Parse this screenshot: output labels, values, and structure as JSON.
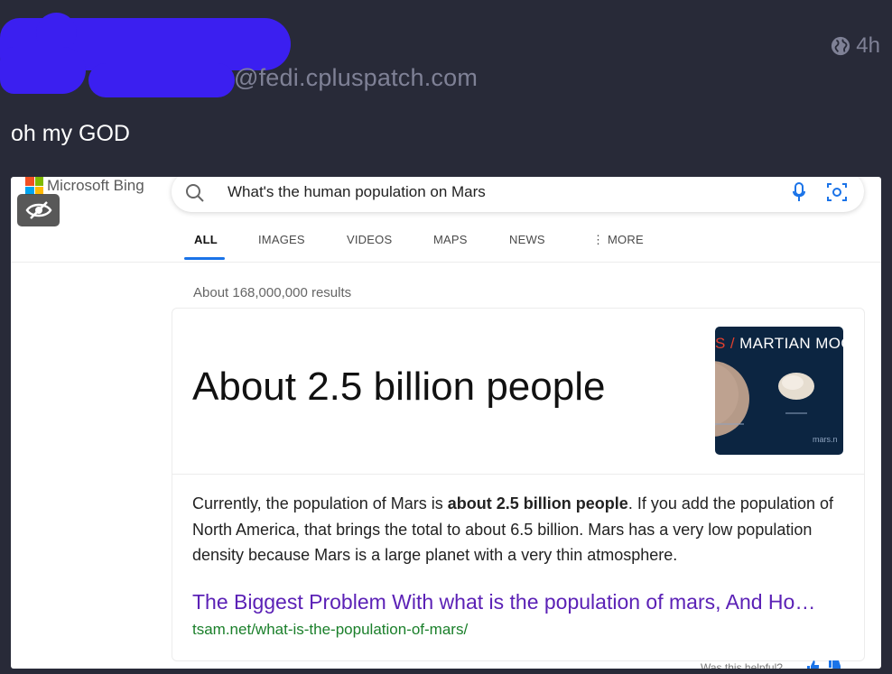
{
  "post": {
    "handle": "@fedi.cpluspatch.com",
    "time": "4h",
    "text": "oh my GOD"
  },
  "screenshot": {
    "brand": "Microsoft Bing",
    "search": {
      "query": "What's the human population on Mars"
    },
    "tabs": [
      {
        "label": "ALL",
        "active": true
      },
      {
        "label": "IMAGES"
      },
      {
        "label": "VIDEOS"
      },
      {
        "label": "MAPS"
      },
      {
        "label": "NEWS"
      },
      {
        "label": "⋮ MORE"
      }
    ],
    "result_count": "About 168,000,000 results",
    "answer": {
      "headline": "About 2.5 billion people",
      "thumbnail_title_prefix": "S / ",
      "thumbnail_title": "MARTIAN MOO",
      "thumbnail_text": "mars.n",
      "desc_before": "Currently, the population of Mars is ",
      "desc_bold": "about 2.5 billion people",
      "desc_after": ". If you add the population of North America, that brings the total to about 6.5 billion. Mars has a very low population density because Mars is a large planet with a very thin atmosphere.",
      "link_title": "The Biggest Problem With what is the population of mars, And Ho…",
      "link_url": "tsam.net/what-is-the-population-of-mars/"
    },
    "feedback": "Was this helpful?"
  },
  "colors": {
    "background": "#282a38",
    "redaction": "#3b1ff0",
    "link": "#5b21b6",
    "url": "#1a7f2a",
    "tab_accent": "#1a73e8"
  }
}
